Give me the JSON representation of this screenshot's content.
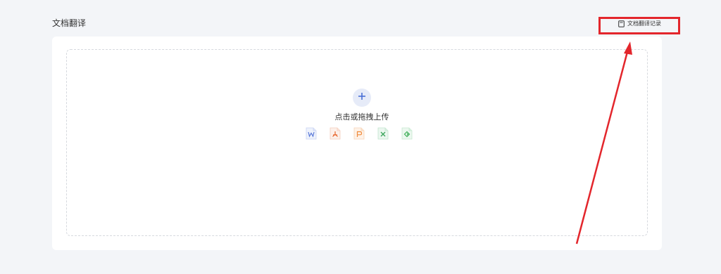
{
  "page": {
    "title": "文档翻译"
  },
  "header": {
    "history_label": "文档翻译记录",
    "history_icon": "document-icon"
  },
  "upload": {
    "plus_icon": "plus-icon",
    "prompt": "点击或拖拽上传",
    "file_types": [
      {
        "icon": "word-file-icon",
        "color": "#5b79d8"
      },
      {
        "icon": "pdf-file-icon",
        "color": "#e8672f"
      },
      {
        "icon": "ppt-file-icon",
        "color": "#f08a3a"
      },
      {
        "icon": "excel-file-icon",
        "color": "#3aa55b"
      },
      {
        "icon": "epub-file-icon",
        "color": "#43b05c"
      }
    ]
  },
  "annotation": {
    "color": "#e3262c"
  }
}
